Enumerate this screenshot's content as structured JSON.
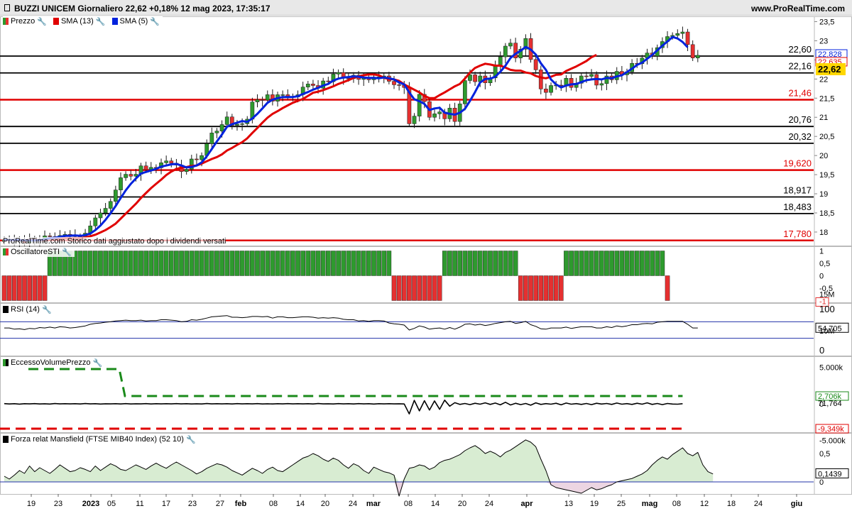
{
  "header": {
    "title": "BUZZI UNICEM Giornaliero 22,62 +0,18% 12 mag 2023, 17:35:17",
    "site": "www.ProRealTime.com"
  },
  "legend": {
    "price": "Prezzo",
    "sma13": "SMA (13)",
    "sma5": "SMA (5)",
    "osc": "OscillatoreSTI",
    "rsi": "RSI (14)",
    "evp": "EccessoVolumePrezzo",
    "mans": "Forza relat Mansfield (FTSE MIB40 Index) (52 10)"
  },
  "note": "ProRealTime.com Storico dati aggiustato dopo i dividendi versati",
  "colors": {
    "up": "#2e9a2e",
    "down": "#e53030",
    "sma13": "#e00000",
    "sma5": "#0022dd",
    "support": "#e00000",
    "resist": "#000000"
  },
  "chart_data": [
    {
      "type": "candlestick",
      "ylim": [
        17.78,
        23.4
      ],
      "yticks": [
        "23,5",
        "23",
        "22,5",
        "22",
        "21,5",
        "21",
        "20,5",
        "20",
        "19,5",
        "19",
        "18,5",
        "18"
      ],
      "x_ticks": [
        "19",
        "23",
        "2023",
        "05",
        "11",
        "17",
        "23",
        "27",
        "feb",
        "08",
        "14",
        "20",
        "24",
        "mar",
        "08",
        "14",
        "20",
        "24",
        "apr",
        "13",
        "19",
        "25",
        "mag",
        "08",
        "12",
        "18",
        "24",
        "giu"
      ],
      "close": [
        17.8,
        17.79,
        17.77,
        17.81,
        17.71,
        17.82,
        17.79,
        17.81,
        17.9,
        17.88,
        17.86,
        17.91,
        17.94,
        17.93,
        17.88,
        17.86,
        17.97,
        18.16,
        18.37,
        18.5,
        18.62,
        18.8,
        19.1,
        19.42,
        19.51,
        19.46,
        19.51,
        19.73,
        19.63,
        19.69,
        19.68,
        19.81,
        19.86,
        19.8,
        19.75,
        19.58,
        19.64,
        19.91,
        19.89,
        20.0,
        20.31,
        20.59,
        20.64,
        20.81,
        21.01,
        20.79,
        20.82,
        20.83,
        20.95,
        21.4,
        21.46,
        21.45,
        21.59,
        21.42,
        21.59,
        21.59,
        21.54,
        21.53,
        21.59,
        21.79,
        21.87,
        21.83,
        21.76,
        21.95,
        21.93,
        22.13,
        22.17,
        22.02,
        22.01,
        22.1,
        21.99,
        22.03,
        21.98,
        22.05,
        22.06,
        22.08,
        21.94,
        21.85,
        21.84,
        21.78,
        20.83,
        21.03,
        21.6,
        21.41,
        21.0,
        21.09,
        21.14,
        20.96,
        21.24,
        20.89,
        21.35,
        21.96,
        22.11,
        21.93,
        22.08,
        21.9,
        22.03,
        22.37,
        22.58,
        22.86,
        22.94,
        22.55,
        22.78,
        23.06,
        22.51,
        22.24,
        21.74,
        21.65,
        21.83,
        21.84,
        21.83,
        22.02,
        21.78,
        21.89,
        22.08,
        22.07,
        22.12,
        21.84,
        21.88,
        22.08,
        21.98,
        22.2,
        22.11,
        22.19,
        22.41,
        22.4,
        22.55,
        22.68,
        22.6,
        22.82,
        22.98,
        23.11,
        23.14,
        23.19,
        23.23,
        22.9,
        22.55,
        22.62
      ],
      "sma13": [
        17.8,
        17.79,
        17.79,
        17.79,
        17.78,
        17.79,
        17.79,
        17.79,
        17.8,
        17.81,
        17.82,
        17.82,
        17.84,
        17.84,
        17.84,
        17.84,
        17.86,
        17.89,
        17.93,
        17.99,
        18.05,
        18.13,
        18.22,
        18.35,
        18.48,
        18.61,
        18.74,
        18.89,
        19.02,
        19.15,
        19.26,
        19.37,
        19.49,
        19.58,
        19.65,
        19.68,
        19.7,
        19.73,
        19.74,
        19.79,
        19.85,
        19.91,
        19.96,
        20.03,
        20.13,
        20.2,
        20.28,
        20.35,
        20.45,
        20.59,
        20.72,
        20.86,
        20.99,
        21.09,
        21.16,
        21.24,
        21.31,
        21.38,
        21.43,
        21.48,
        21.56,
        21.64,
        21.67,
        21.71,
        21.76,
        21.81,
        21.87,
        21.92,
        21.97,
        22.03,
        22.07,
        22.1,
        22.12,
        22.12,
        22.1,
        22.03,
        22.0,
        21.99,
        21.95,
        21.86,
        21.79,
        21.72,
        21.65,
        21.56,
        21.5,
        21.5,
        21.58,
        21.65,
        21.73,
        21.81,
        21.87,
        22.01,
        22.17,
        22.29,
        22.35,
        22.4,
        22.38,
        22.35,
        22.35,
        22.3,
        22.24,
        22.22,
        22.22,
        22.17,
        22.15,
        22.08,
        22.04,
        22.02,
        22.06,
        22.11,
        22.12,
        22.21,
        22.27,
        22.33,
        22.4,
        22.47,
        22.57,
        22.63
      ],
      "sma5": [
        17.8,
        17.79,
        17.79,
        17.79,
        17.78,
        17.78,
        17.78,
        17.79,
        17.81,
        17.84,
        17.85,
        17.87,
        17.9,
        17.9,
        17.91,
        17.9,
        17.92,
        17.96,
        18.05,
        18.17,
        18.32,
        18.49,
        18.68,
        18.89,
        19.09,
        19.26,
        19.4,
        19.53,
        19.57,
        19.61,
        19.65,
        19.71,
        19.74,
        19.77,
        19.78,
        19.74,
        19.69,
        19.7,
        19.74,
        19.82,
        19.98,
        20.17,
        20.37,
        20.55,
        20.75,
        20.82,
        20.86,
        20.9,
        20.88,
        20.97,
        21.09,
        21.23,
        21.38,
        21.46,
        21.5,
        21.53,
        21.53,
        21.53,
        21.55,
        21.61,
        21.66,
        21.72,
        21.77,
        21.83,
        21.87,
        21.96,
        22.01,
        22.04,
        22.05,
        22.07,
        22.06,
        22.04,
        22.03,
        22.03,
        22.02,
        22.04,
        22.02,
        21.99,
        21.91,
        21.86,
        21.65,
        21.47,
        21.42,
        21.35,
        21.19,
        21.23,
        21.25,
        21.12,
        21.09,
        21.07,
        21.12,
        21.22,
        21.43,
        21.66,
        21.91,
        22.0,
        22.01,
        22.06,
        22.19,
        22.35,
        22.55,
        22.66,
        22.74,
        22.84,
        22.77,
        22.64,
        22.41,
        22.24,
        21.99,
        21.86,
        21.78,
        21.83,
        21.86,
        21.87,
        21.92,
        21.97,
        21.99,
        22.0,
        21.99,
        22.03,
        22.02,
        22.07,
        22.1,
        22.18,
        22.27,
        22.37,
        22.43,
        22.53,
        22.63,
        22.75,
        22.87,
        22.98,
        23.1,
        23.06,
        22.97,
        22.83
      ],
      "levels": [
        {
          "value": 22.6,
          "label": "22,60",
          "kind": "resistance"
        },
        {
          "value": 22.16,
          "label": "22,16",
          "kind": "resistance"
        },
        {
          "value": 21.46,
          "label": "21,46",
          "kind": "support"
        },
        {
          "value": 20.76,
          "label": "20,76",
          "kind": "resistance"
        },
        {
          "value": 20.32,
          "label": "20,32",
          "kind": "resistance"
        },
        {
          "value": 19.62,
          "label": "19,620",
          "kind": "support"
        },
        {
          "value": 18.917,
          "label": "18,917",
          "kind": "resistance"
        },
        {
          "value": 18.483,
          "label": "18,483",
          "kind": "resistance"
        },
        {
          "value": 17.78,
          "label": "17,780",
          "kind": "support"
        }
      ],
      "price_tags": [
        {
          "label": "22,828",
          "color": "#0022dd"
        },
        {
          "label": "22,635",
          "color": "#e00000"
        },
        {
          "label": "22,62",
          "color": "#ffd700"
        }
      ]
    },
    {
      "type": "bar",
      "title": "OscillatoreSTI",
      "ylim": [
        -1,
        1
      ],
      "yticks": [
        "1",
        "0,5",
        "0",
        "-0,5",
        "-1"
      ],
      "last": "-1",
      "segments": [
        {
          "value": -1,
          "count": 9
        },
        {
          "value": 1,
          "count": 68
        },
        {
          "value": -1,
          "count": 10
        },
        {
          "value": 1,
          "count": 15
        },
        {
          "value": -1,
          "count": 9
        },
        {
          "value": 1,
          "count": 20
        },
        {
          "value": -1,
          "count": 1
        }
      ]
    },
    {
      "type": "line",
      "title": "RSI (14)",
      "ylim": [
        0,
        100
      ],
      "yticks": [
        "100",
        "50",
        "0"
      ],
      "last": "54,705",
      "values": [
        55,
        55,
        52,
        53,
        51,
        54,
        53,
        56,
        55,
        57,
        55,
        58,
        57,
        55,
        56,
        58,
        60,
        64,
        66,
        67,
        69,
        70,
        72,
        73,
        74,
        73,
        73,
        74,
        72,
        73,
        73,
        75,
        75,
        74,
        73,
        70,
        71,
        75,
        74,
        76,
        79,
        82,
        83,
        84,
        85,
        81,
        81,
        80,
        81,
        83,
        83,
        82,
        83,
        79,
        82,
        82,
        80,
        80,
        81,
        82,
        82,
        81,
        79,
        80,
        79,
        80,
        79,
        76,
        75,
        75,
        72,
        73,
        71,
        73,
        73,
        72,
        67,
        65,
        64,
        62,
        50,
        54,
        60,
        57,
        52,
        54,
        55,
        52,
        56,
        52,
        57,
        64,
        65,
        62,
        64,
        61,
        63,
        66,
        68,
        70,
        71,
        66,
        68,
        71,
        63,
        59,
        53,
        52,
        55,
        55,
        55,
        57,
        54,
        56,
        58,
        58,
        58,
        55,
        55,
        58,
        56,
        60,
        58,
        60,
        63,
        63,
        65,
        66,
        65,
        69,
        70,
        71,
        71,
        71,
        71,
        64,
        55,
        55
      ]
    },
    {
      "type": "line",
      "title": "EccessoVolumePrezzo",
      "yticks": [
        "15M",
        "10M",
        "5.000k",
        "0",
        "-5.000k"
      ],
      "last_labels": [
        "2,706k",
        "71,764",
        "-9,349k"
      ],
      "upper_band": 2706,
      "lower_band": -9349,
      "upper_start": 12300,
      "values": [
        120,
        -80,
        60,
        -140,
        90,
        -30,
        110,
        -60,
        40,
        -100,
        150,
        -50,
        80,
        -20,
        60,
        -90,
        130,
        -40,
        70,
        -110,
        50,
        -30,
        90,
        -60,
        120,
        -80,
        40,
        -20,
        100,
        -70,
        60,
        -40,
        80,
        -50,
        110,
        -30,
        70,
        -90,
        50,
        -60,
        140,
        -40,
        90,
        -30,
        60,
        -80,
        120,
        -50,
        70,
        -20,
        100,
        -60,
        40,
        -90,
        80,
        -30,
        110,
        -50,
        60,
        -40,
        90,
        -70,
        130,
        -30,
        50,
        -80,
        100,
        -40,
        70,
        -60,
        120,
        -20,
        60,
        -100,
        80,
        -50,
        90,
        -30,
        40,
        -60,
        -5200,
        1800,
        -3600,
        1600,
        -3200,
        1500,
        -2800,
        1900,
        -1200,
        600,
        -300,
        200,
        -400,
        300,
        -200,
        500,
        -300,
        400,
        -500,
        800,
        -600,
        300,
        -400,
        200,
        -700,
        500,
        -300,
        100,
        -200,
        300,
        -500,
        400,
        -200,
        100,
        -300,
        200,
        -400,
        300,
        -100,
        200,
        -300,
        400,
        -200,
        100,
        -300,
        300,
        -200,
        500,
        -300,
        200,
        -400,
        200,
        -100,
        -200,
        72
      ]
    },
    {
      "type": "area",
      "title": "Forza relat Mansfield (FTSE MIB40 Index) (52 10)",
      "ylim": [
        -0.3,
        0.8
      ],
      "yticks": [
        "0,5",
        "0"
      ],
      "last": "0,1439",
      "values": [
        0.1,
        0.05,
        0.12,
        0.2,
        0.15,
        0.28,
        0.18,
        0.25,
        0.2,
        0.15,
        0.22,
        0.3,
        0.24,
        0.18,
        0.2,
        0.25,
        0.22,
        0.18,
        0.28,
        0.2,
        0.26,
        0.32,
        0.28,
        0.22,
        0.2,
        0.25,
        0.3,
        0.26,
        0.22,
        0.28,
        0.33,
        0.28,
        0.24,
        0.3,
        0.35,
        0.3,
        0.25,
        0.2,
        0.14,
        0.18,
        0.24,
        0.28,
        0.32,
        0.3,
        0.26,
        0.2,
        0.16,
        0.12,
        0.18,
        0.24,
        0.2,
        0.15,
        0.22,
        0.26,
        0.2,
        0.18,
        0.24,
        0.3,
        0.36,
        0.42,
        0.45,
        0.5,
        0.46,
        0.4,
        0.36,
        0.42,
        0.38,
        0.3,
        0.24,
        0.32,
        0.28,
        0.2,
        0.15,
        0.26,
        0.22,
        0.18,
        0.16,
        0.12,
        -0.25,
        0.05,
        0.24,
        0.26,
        0.3,
        0.28,
        0.22,
        0.26,
        0.34,
        0.38,
        0.4,
        0.44,
        0.48,
        0.55,
        0.6,
        0.64,
        0.58,
        0.5,
        0.54,
        0.5,
        0.44,
        0.52,
        0.56,
        0.62,
        0.68,
        0.74,
        0.7,
        0.62,
        0.4,
        0.2,
        -0.05,
        -0.1,
        -0.12,
        -0.14,
        -0.16,
        -0.18,
        -0.2,
        -0.15,
        -0.1,
        -0.14,
        -0.12,
        -0.08,
        -0.05,
        0.0,
        0.02,
        0.04,
        0.06,
        0.1,
        0.14,
        0.2,
        0.3,
        0.38,
        0.44,
        0.4,
        0.48,
        0.54,
        0.6,
        0.5,
        0.46,
        0.52,
        0.3,
        0.18,
        0.14
      ]
    }
  ]
}
